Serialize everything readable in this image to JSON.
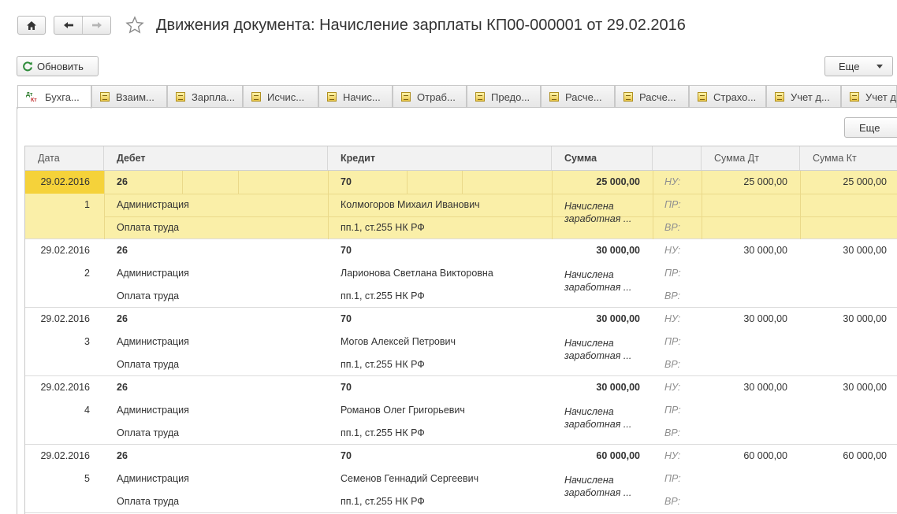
{
  "header": {
    "title": "Движения документа: Начисление зарплаты КП00-000001 от 29.02.2016"
  },
  "toolbar": {
    "refresh_label": "Обновить",
    "more_label": "Еще",
    "more_label_2": "Еще"
  },
  "tabs": [
    {
      "label": "Бухга..."
    },
    {
      "label": "Взаим..."
    },
    {
      "label": "Зарпла..."
    },
    {
      "label": "Исчис..."
    },
    {
      "label": "Начис..."
    },
    {
      "label": "Отраб..."
    },
    {
      "label": "Предо..."
    },
    {
      "label": "Расче..."
    },
    {
      "label": "Расче..."
    },
    {
      "label": "Страхо..."
    },
    {
      "label": "Учет д..."
    },
    {
      "label": "Учет д"
    }
  ],
  "grid": {
    "columns": {
      "date": "Дата",
      "debit": "Дебет",
      "credit": "Кредит",
      "sum": "Сумма",
      "sum_dt": "Сумма Дт",
      "sum_kt": "Сумма Кт"
    },
    "rows": [
      {
        "date": "29.02.2016",
        "num": "1",
        "debit": "26",
        "debit_sub1": "Администрация",
        "debit_sub2": "Оплата труда",
        "credit": "70",
        "credit_sub1": "Колмогоров Михаил Иванович",
        "credit_sub2": "пп.1, ст.255 НК РФ",
        "sum": "25 000,00",
        "content": "Начислена заработная ...",
        "nu": "НУ:",
        "pr": "ПР:",
        "vr": "ВР:",
        "sum_dt": "25 000,00",
        "sum_kt": "25 000,00"
      },
      {
        "date": "29.02.2016",
        "num": "2",
        "debit": "26",
        "debit_sub1": "Администрация",
        "debit_sub2": "Оплата труда",
        "credit": "70",
        "credit_sub1": "Ларионова Светлана Викторовна",
        "credit_sub2": "пп.1, ст.255 НК РФ",
        "sum": "30 000,00",
        "content": "Начислена заработная ...",
        "nu": "НУ:",
        "pr": "ПР:",
        "vr": "ВР:",
        "sum_dt": "30 000,00",
        "sum_kt": "30 000,00"
      },
      {
        "date": "29.02.2016",
        "num": "3",
        "debit": "26",
        "debit_sub1": "Администрация",
        "debit_sub2": "Оплата труда",
        "credit": "70",
        "credit_sub1": "Могов Алексей Петрович",
        "credit_sub2": "пп.1, ст.255 НК РФ",
        "sum": "30 000,00",
        "content": "Начислена заработная ...",
        "nu": "НУ:",
        "pr": "ПР:",
        "vr": "ВР:",
        "sum_dt": "30 000,00",
        "sum_kt": "30 000,00"
      },
      {
        "date": "29.02.2016",
        "num": "4",
        "debit": "26",
        "debit_sub1": "Администрация",
        "debit_sub2": "Оплата труда",
        "credit": "70",
        "credit_sub1": "Романов Олег Григорьевич",
        "credit_sub2": "пп.1, ст.255 НК РФ",
        "sum": "30 000,00",
        "content": "Начислена заработная ...",
        "nu": "НУ:",
        "pr": "ПР:",
        "vr": "ВР:",
        "sum_dt": "30 000,00",
        "sum_kt": "30 000,00"
      },
      {
        "date": "29.02.2016",
        "num": "5",
        "debit": "26",
        "debit_sub1": "Администрация",
        "debit_sub2": "Оплата труда",
        "credit": "70",
        "credit_sub1": "Семенов Геннадий Сергеевич",
        "credit_sub2": "пп.1, ст.255 НК РФ",
        "sum": "60 000,00",
        "content": "Начислена заработная ...",
        "nu": "НУ:",
        "pr": "ПР:",
        "vr": "ВР:",
        "sum_dt": "60 000,00",
        "sum_kt": "60 000,00"
      }
    ]
  },
  "colors": {
    "selected_row": "#faefa8",
    "selected_date": "#f5d23a",
    "header_bg": "#f2f2f2"
  }
}
